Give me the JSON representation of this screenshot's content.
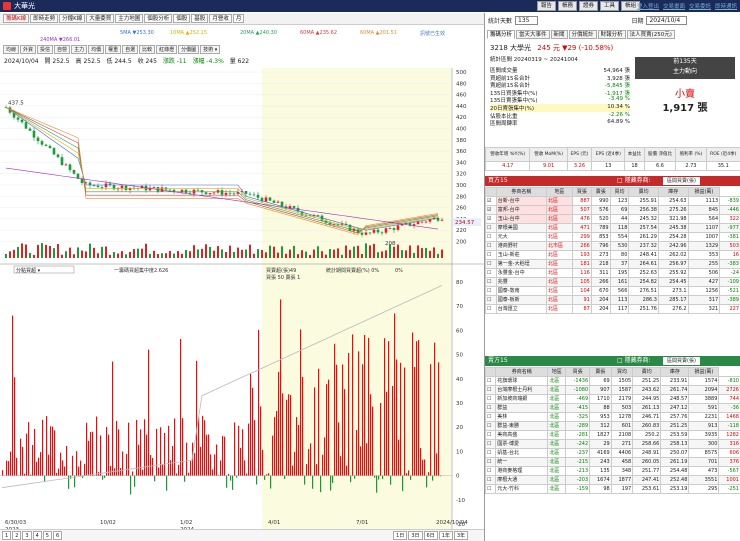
{
  "app": {
    "title": "大華光",
    "top_buttons": [
      "報告",
      "帳務",
      "證券",
      "工具",
      "帳組"
    ],
    "top_links": [
      "登入登出",
      "交易畫面",
      "交易委託",
      "即時通訊"
    ]
  },
  "menubar": [
    "籌碼K線",
    "即時走勢",
    "分鐘K線",
    "大量委買",
    "主力地圖",
    "個股分析",
    "個股",
    "基股",
    "月營收",
    "月"
  ],
  "ma_legend": [
    {
      "label": "5MA ▼253.30",
      "color": "#3a6de0"
    },
    {
      "label": "10MA ▲252.15",
      "color": "#e0b000"
    },
    {
      "label": "20MA ▲240.30",
      "color": "#2aa060"
    },
    {
      "label": "60MA ▲235.62",
      "color": "#d04040"
    },
    {
      "label": "60MA ▲201.51",
      "color": "#e09030"
    },
    {
      "label": "240MA ▼266.01",
      "color": "#a030c0"
    }
  ],
  "ma_note": "訊號已生效",
  "toolbar": [
    "均線",
    "外資",
    "投信",
    "自營",
    "主力",
    "均價",
    "權重",
    "自選",
    "比較",
    "紅綠燈",
    "分價圖"
  ],
  "toolbar_select": "技術",
  "price_row": {
    "date": "2024/10/04",
    "open": "開 252.5",
    "high": "高 252.5",
    "low": "低 244.5",
    "close": "收 245",
    "change": "漲跌 -11",
    "pct": "漲幅 -4.3%",
    "vol": "量 622"
  },
  "chart": {
    "price_axis": [
      "500",
      "480",
      "460",
      "440",
      "420",
      "400",
      "380",
      "360",
      "340",
      "320",
      "300",
      "280",
      "260",
      "240",
      "220",
      "200"
    ],
    "price_high": "437.5",
    "price_low": "208",
    "last_price": "234.57",
    "price_now": "245",
    "lower_axis": [
      "80",
      "70",
      "60",
      "50",
      "40",
      "30",
      "20",
      "10",
      "0",
      "-10",
      "-20"
    ],
    "lower_labels": {
      "select": "分點買超",
      "a": "一籌碼買超集中度2.626",
      "b": "買賣超(張)49",
      "c": "買張 50 賣張 1",
      "d": "統計期間買賣超(%) 0%",
      "e": "0%"
    },
    "x_labels": [
      "6/30/03",
      "10/02",
      "1/02",
      "4/01",
      "7/01",
      "2024/10/04"
    ],
    "x_sub": [
      "2023",
      "",
      "2024",
      "",
      "",
      ""
    ]
  },
  "bottomnav": [
    "1",
    "2",
    "3",
    "4",
    "5",
    "6",
    "1日",
    "3日",
    "6日",
    "1年",
    "3年"
  ],
  "right": {
    "stat_select": "統計天數",
    "stat_days": "135",
    "date_label": "日期",
    "date": "2024/10/4",
    "tabs": [
      "籌碼分析",
      "當天大事件",
      "新聞",
      "分價統計",
      "財報分析",
      "法人買賣(250元)"
    ],
    "stock": "3218 大學光",
    "stock_price": "245 元 ▼29 (-10.58%)",
    "period": "統計區間 20240319 ~ 20241004",
    "stats": [
      [
        "區間成交量",
        "54,964 張"
      ],
      [
        "買超前15名合計",
        "3,928 張"
      ],
      [
        "賣超前15名合計",
        "-5,845 張"
      ],
      [
        "135日買張集中(%)",
        "-1,917 張"
      ],
      [
        "135日賣張集中(%)",
        "-3.49 %"
      ],
      [
        "20日賣張集中(%)",
        "10.34 %"
      ],
      [
        "佔股本比重",
        "-2.26 %"
      ],
      [
        "區間周轉率",
        "64.89 %"
      ]
    ],
    "side_top": "前135天",
    "side_mid": "主力動向",
    "side_label": "小賣",
    "side_value": "1,917 張",
    "fund_headers": [
      "營收年增\nYoY(%)",
      "營收\nMoM(%)",
      "EPS\n(元)",
      "EPS\n(近4季)",
      "本益比",
      "股價\n淨值比",
      "殖利率\n(%)",
      "ROE\n(近4季)"
    ],
    "fund_values": [
      "4.17",
      "9.01",
      "3.26",
      "13",
      "18",
      "6.6",
      "2.73",
      "35.1"
    ],
    "buy_title": "買方15",
    "sell_title": "賣方15",
    "filter": "□ 隱藏券商:",
    "filter_select": "區間買賣(張)",
    "buy_headers": [
      "",
      "券商名稱",
      "地區",
      "買張",
      "賣張",
      "買均",
      "賣均",
      "庫存",
      "損益(萬)"
    ],
    "buy_rows": [
      [
        "☑",
        "台新-台中",
        "北區",
        "887",
        "990",
        "123",
        "255.91",
        "254.63",
        "1113",
        "-839"
      ],
      [
        "☑",
        "富邦-台中",
        "北區",
        "507",
        "576",
        "69",
        "256.38",
        "275.26",
        "845",
        "-446"
      ],
      [
        "☑",
        "玉山-台中",
        "北區",
        "476",
        "520",
        "44",
        "245.32",
        "321.98",
        "564",
        "322"
      ],
      [
        "☐",
        "摩根美國",
        "北區",
        "471",
        "789",
        "118",
        "257.54",
        "245.38",
        "1107",
        "-977"
      ],
      [
        "☐",
        "元大",
        "北區",
        "299",
        "853",
        "554",
        "261.29",
        "254.28",
        "1007",
        "-381"
      ],
      [
        "☐",
        "港商野村",
        "北市區",
        "266",
        "796",
        "530",
        "237.32",
        "242.96",
        "1329",
        "503"
      ],
      [
        "☐",
        "玉山-新莊",
        "北區",
        "193",
        "273",
        "80",
        "248.41",
        "262.02",
        "353",
        "16"
      ],
      [
        "☐",
        "第一金-大稻埕",
        "北區",
        "181",
        "218",
        "37",
        "264.61",
        "256.97",
        "255",
        "-383"
      ],
      [
        "☐",
        "永豐金-台中",
        "北區",
        "116",
        "311",
        "195",
        "252.63",
        "255.92",
        "506",
        "-24"
      ],
      [
        "☐",
        "兆豐",
        "北區",
        "105",
        "266",
        "161",
        "254.82",
        "254.45",
        "427",
        "-109"
      ],
      [
        "☐",
        "國泰-敦南",
        "北區",
        "104",
        "670",
        "566",
        "276.51",
        "273.1",
        "1256",
        "-521"
      ],
      [
        "☐",
        "國泰-板新",
        "北區",
        "91",
        "204",
        "113",
        "286.3",
        "285.17",
        "317",
        "-389"
      ],
      [
        "☐",
        "台灣匯立",
        "北區",
        "87",
        "204",
        "117",
        "251.76",
        "276.2",
        "321",
        "227"
      ]
    ],
    "sell_rows": [
      [
        "☐",
        "花旗環球",
        "北區",
        "-1436",
        "69",
        "1505",
        "251.25",
        "233.91",
        "1574",
        "-810"
      ],
      [
        "☐",
        "台灣摩根士丹利",
        "北區",
        "-1080",
        "907",
        "1587",
        "243.62",
        "261.74",
        "2094",
        "2726"
      ],
      [
        "☐",
        "新加坡商瑞銀",
        "北區",
        "-469",
        "1710",
        "2179",
        "244.95",
        "248.57",
        "3889",
        "744"
      ],
      [
        "☐",
        "群益",
        "北區",
        "-415",
        "88",
        "503",
        "261.13",
        "247.12",
        "591",
        "-36"
      ],
      [
        "☐",
        "美林",
        "北區",
        "-325",
        "953",
        "1278",
        "246.71",
        "257.76",
        "2231",
        "1468"
      ],
      [
        "☐",
        "群益-東勝",
        "北區",
        "-289",
        "312",
        "601",
        "260.83",
        "251.25",
        "913",
        "-118"
      ],
      [
        "☐",
        "美商高盛",
        "北區",
        "-281",
        "1827",
        "2108",
        "250.2",
        "253.59",
        "3935",
        "1282"
      ],
      [
        "☐",
        "國票-博愛",
        "北區",
        "-242",
        "29",
        "271",
        "258.66",
        "258.13",
        "300",
        "316"
      ],
      [
        "☐",
        "凱基-台北",
        "北區",
        "-237",
        "4169",
        "4406",
        "248.91",
        "250.07",
        "8575",
        "606"
      ],
      [
        "☐",
        "統一",
        "北區",
        "-215",
        "243",
        "458",
        "260.05",
        "261.19",
        "701",
        "376"
      ],
      [
        "☐",
        "港商麥格理",
        "北區",
        "-213",
        "135",
        "348",
        "251.77",
        "254.48",
        "473",
        "-567"
      ],
      [
        "☐",
        "摩根大通",
        "北區",
        "-203",
        "1674",
        "1877",
        "247.41",
        "252.48",
        "3551",
        "1001"
      ],
      [
        "☐",
        "元大-竹科",
        "北區",
        "-159",
        "98",
        "197",
        "253.61",
        "253.19",
        "295",
        "-251"
      ]
    ]
  }
}
